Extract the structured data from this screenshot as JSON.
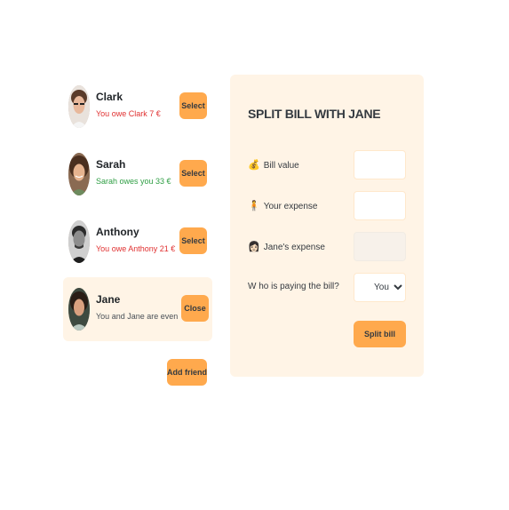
{
  "friends": [
    {
      "name": "Clark",
      "status": "You owe Clark 7 €",
      "status_type": "owe",
      "button": "Select",
      "avatar": "clark-avatar"
    },
    {
      "name": "Sarah",
      "status": "Sarah owes you 33 €",
      "status_type": "owed",
      "button": "Select",
      "avatar": "sarah-avatar"
    },
    {
      "name": "Anthony",
      "status": "You owe Anthony 21 €",
      "status_type": "owe",
      "button": "Select",
      "avatar": "anthony-avatar"
    },
    {
      "name": "Jane",
      "status": "You and Jane are even",
      "status_type": "even",
      "button": "Close",
      "avatar": "jane-avatar"
    }
  ],
  "add_friend_label": "Add friend",
  "split_form": {
    "title": "SPLIT BILL WITH JANE",
    "fields": {
      "bill_value": {
        "icon": "💰",
        "label": "Bill value",
        "value": ""
      },
      "your_expense": {
        "icon": "🧍",
        "label": "Your expense",
        "value": ""
      },
      "friend_expense": {
        "icon": "👩🏻",
        "label": "Jane's expense",
        "value": ""
      },
      "payer": {
        "label": "W ho is paying the bill?",
        "selected": "You",
        "options": [
          "You"
        ]
      }
    },
    "submit_label": "Split bill"
  },
  "colors": {
    "accent": "#ffa94d",
    "panel_bg": "#fff4e6",
    "owe_red": "#e03131",
    "owed_green": "#2f9e44"
  }
}
